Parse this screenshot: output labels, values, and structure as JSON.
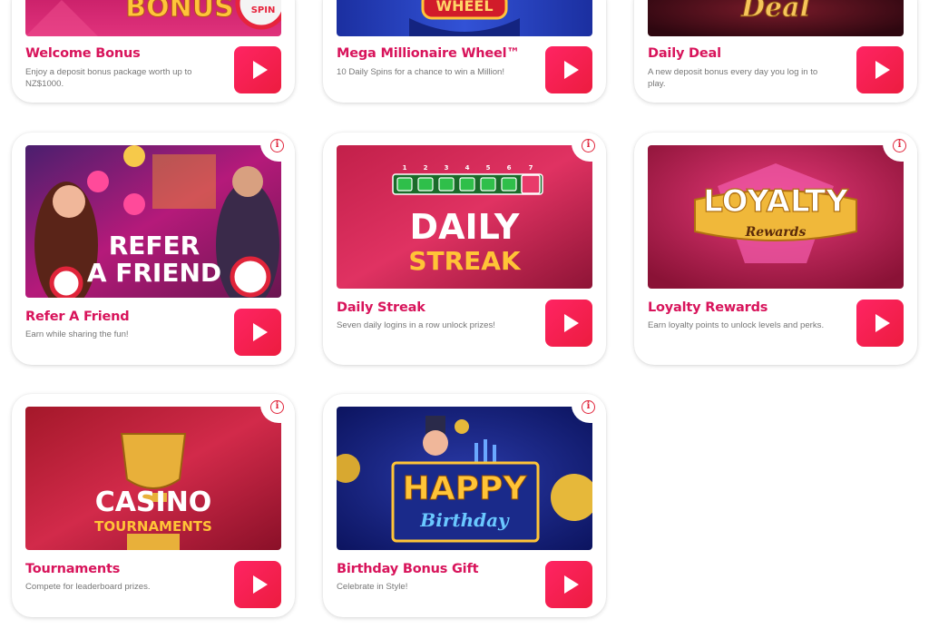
{
  "colors": {
    "accent": "#d8145b",
    "play": "#f2204b",
    "info": "#e0243a"
  },
  "icons": {
    "play": "play-icon",
    "info": "info-icon"
  },
  "cards": [
    {
      "title": "Welcome Bonus",
      "desc": "Enjoy a deposit bonus package worth up to NZ$1000.",
      "art": [
        "BONUS",
        "SPIN"
      ]
    },
    {
      "title": "Mega Millionaire Wheel™",
      "desc": "10 Daily Spins for a chance to win a Million!",
      "art": [
        "WHEEL"
      ]
    },
    {
      "title": "Daily Deal",
      "desc": "A new deposit bonus every day you log in to play.",
      "art": [
        "Deal"
      ]
    },
    {
      "title": "Refer A Friend",
      "desc": "Earn while sharing the fun!",
      "art": [
        "REFER",
        "A FRIEND"
      ]
    },
    {
      "title": "Daily Streak",
      "desc": "Seven daily logins in a row unlock prizes!",
      "art": [
        "DAILY",
        "STREAK",
        "1",
        "2",
        "3",
        "4",
        "5",
        "6",
        "7"
      ]
    },
    {
      "title": "Loyalty Rewards",
      "desc": "Earn loyalty points to unlock levels and perks.",
      "art": [
        "LOYALTY",
        "Rewards"
      ]
    },
    {
      "title": "Tournaments",
      "desc": "Compete for leaderboard prizes.",
      "art": [
        "CASINO",
        "TOURNAMENTS"
      ]
    },
    {
      "title": "Birthday Bonus Gift",
      "desc": "Celebrate in Style!",
      "art": [
        "HAPPY",
        "Birthday"
      ]
    }
  ]
}
